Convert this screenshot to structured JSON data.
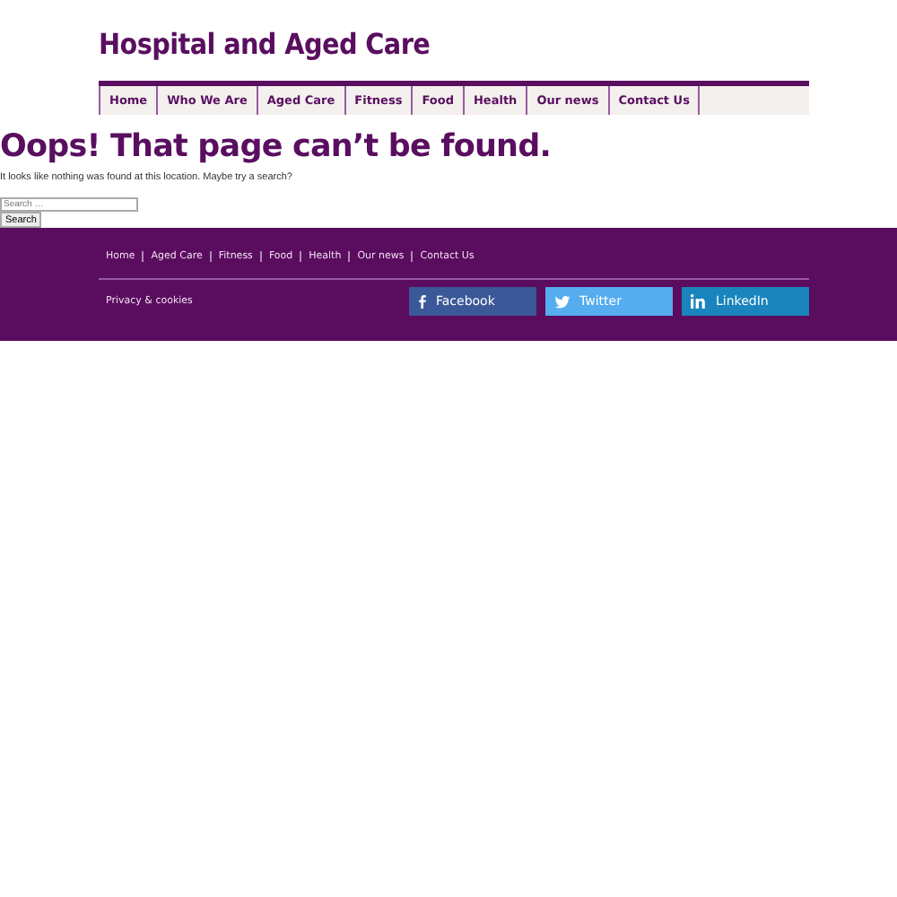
{
  "site_title": "Hospital and Aged Care",
  "nav": [
    {
      "label": "Home"
    },
    {
      "label": "Who We Are"
    },
    {
      "label": "Aged Care"
    },
    {
      "label": "Fitness"
    },
    {
      "label": "Food"
    },
    {
      "label": "Health"
    },
    {
      "label": "Our news"
    },
    {
      "label": "Contact Us"
    }
  ],
  "heading": "Oops! That page can’t be found.",
  "message": "It looks like nothing was found at this location. Maybe try a search?",
  "search": {
    "placeholder": "Search …",
    "button": "Search"
  },
  "footer": {
    "links": [
      "Home",
      "Aged Care",
      "Fitness",
      "Food",
      "Health",
      "Our news",
      "Contact Us"
    ],
    "privacy": "Privacy & cookies",
    "social": [
      {
        "kind": "facebook",
        "label": "Facebook",
        "color": "#3b5998"
      },
      {
        "kind": "twitter",
        "label": "Twitter",
        "color": "#55acee"
      },
      {
        "kind": "linkedin",
        "label": "LinkedIn",
        "color": "#1a84bc"
      }
    ]
  }
}
